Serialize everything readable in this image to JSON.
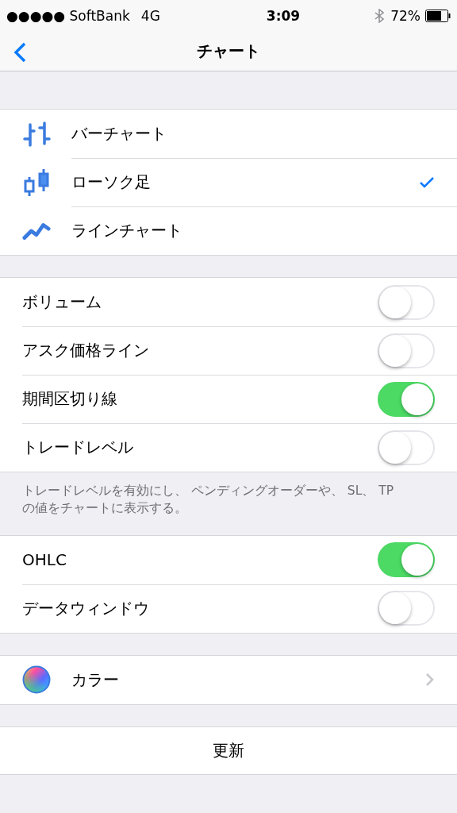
{
  "status_bar": {
    "carrier": "●●●●● SoftBank",
    "network": "4G",
    "time": "3:09",
    "battery": "72%"
  },
  "nav": {
    "title": "チャート"
  },
  "chart_types": [
    {
      "kind": "bar",
      "label": "バーチャート",
      "selected": false
    },
    {
      "kind": "candle",
      "label": "ローソク足",
      "selected": true
    },
    {
      "kind": "line",
      "label": "ラインチャート",
      "selected": false
    }
  ],
  "toggles": [
    {
      "label": "ボリューム",
      "on": false
    },
    {
      "label": "アスク価格ライン",
      "on": false
    },
    {
      "label": "期間区切り線",
      "on": true
    },
    {
      "label": "トレードレベル",
      "on": false
    }
  ],
  "toggles_note": "トレードレベルを有効にし、 ペンディングオーダーや、 SL、 TP の値をチャートに表示する。",
  "toggles_2": [
    {
      "label": "OHLC",
      "on": true
    },
    {
      "label": "データウィンドウ",
      "on": false
    }
  ],
  "color_row": {
    "label": "カラー"
  },
  "update_button": "更新"
}
